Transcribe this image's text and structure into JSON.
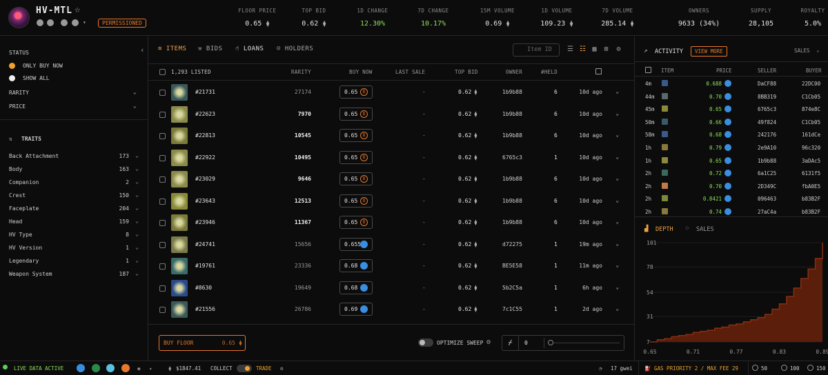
{
  "header": {
    "collection_name": "HV-MTL",
    "badge": "PERMISSIONED",
    "stats": [
      {
        "label": "FLOOR PRICE",
        "value": "0.65",
        "eth": true,
        "green": false
      },
      {
        "label": "TOP BID",
        "value": "0.62",
        "eth": true,
        "green": false
      },
      {
        "label": "1D CHANGE",
        "value": "12.30%",
        "eth": false,
        "green": true
      },
      {
        "label": "7D CHANGE",
        "value": "10.17%",
        "eth": false,
        "green": true
      },
      {
        "label": "15M VOLUME",
        "value": "0.69",
        "eth": true,
        "green": false
      },
      {
        "label": "1D VOLUME",
        "value": "109.23",
        "eth": true,
        "green": false
      },
      {
        "label": "7D VOLUME",
        "value": "285.14",
        "eth": true,
        "green": false
      },
      {
        "label": "OWNERS",
        "value": "9633 (34%)",
        "eth": false,
        "green": false
      },
      {
        "label": "SUPPLY",
        "value": "28,105",
        "eth": false,
        "green": false
      },
      {
        "label": "ROYALTY",
        "value": "5.0%",
        "eth": false,
        "green": false
      }
    ]
  },
  "sidebar": {
    "status_label": "STATUS",
    "only_buy_now": "ONLY BUY NOW",
    "show_all": "SHOW ALL",
    "rarity": "RARITY",
    "price": "PRICE",
    "traits_label": "TRAITS",
    "traits": [
      {
        "name": "Back Attachment",
        "count": "173"
      },
      {
        "name": "Body",
        "count": "163"
      },
      {
        "name": "Companion",
        "count": "2"
      },
      {
        "name": "Crest",
        "count": "150"
      },
      {
        "name": "Faceplate",
        "count": "204"
      },
      {
        "name": "Head",
        "count": "159"
      },
      {
        "name": "HV Type",
        "count": "8"
      },
      {
        "name": "HV Version",
        "count": "1"
      },
      {
        "name": "Legendary",
        "count": "1"
      },
      {
        "name": "Weapon System",
        "count": "187"
      }
    ]
  },
  "main": {
    "tabs": [
      "ITEMS",
      "BIDS",
      "LOANS",
      "HOLDERS"
    ],
    "search_placeholder": "Item ID",
    "columns": {
      "listed": "1,293 LISTED",
      "rarity": "RARITY",
      "buy_now": "BUY NOW",
      "last_sale": "LAST SALE",
      "top_bid": "TOP BID",
      "owner": "OWNER",
      "held": "#HELD"
    },
    "rows": [
      {
        "id": "#21731",
        "rarity": "27174",
        "bold": false,
        "price": "0.65",
        "coin": "org",
        "last": "-",
        "bid": "0.62",
        "owner": "1b9b88",
        "held": "6",
        "time": "10d ago",
        "thumb": "#3a5a5a"
      },
      {
        "id": "#22623",
        "rarity": "7970",
        "bold": true,
        "price": "0.65",
        "coin": "org",
        "last": "-",
        "bid": "0.62",
        "owner": "1b9b88",
        "held": "6",
        "time": "10d ago",
        "thumb": "#8a8a4a"
      },
      {
        "id": "#22813",
        "rarity": "10545",
        "bold": true,
        "price": "0.65",
        "coin": "org",
        "last": "-",
        "bid": "0.62",
        "owner": "1b9b88",
        "held": "6",
        "time": "10d ago",
        "thumb": "#7a7a3a"
      },
      {
        "id": "#22922",
        "rarity": "10495",
        "bold": true,
        "price": "0.65",
        "coin": "org",
        "last": "-",
        "bid": "0.62",
        "owner": "6765c3",
        "held": "1",
        "time": "10d ago",
        "thumb": "#8a8a4a"
      },
      {
        "id": "#23029",
        "rarity": "9646",
        "bold": true,
        "price": "0.65",
        "coin": "org",
        "last": "-",
        "bid": "0.62",
        "owner": "1b9b88",
        "held": "6",
        "time": "10d ago",
        "thumb": "#8a8a4a"
      },
      {
        "id": "#23643",
        "rarity": "12513",
        "bold": true,
        "price": "0.65",
        "coin": "org",
        "last": "-",
        "bid": "0.62",
        "owner": "1b9b88",
        "held": "6",
        "time": "10d ago",
        "thumb": "#8a8a3a"
      },
      {
        "id": "#23946",
        "rarity": "11367",
        "bold": true,
        "price": "0.65",
        "coin": "org",
        "last": "-",
        "bid": "0.62",
        "owner": "1b9b88",
        "held": "6",
        "time": "10d ago",
        "thumb": "#7a7a3a"
      },
      {
        "id": "#24741",
        "rarity": "15656",
        "bold": false,
        "price": "0.655",
        "coin": "blu",
        "last": "-",
        "bid": "0.62",
        "owner": "d72275",
        "held": "1",
        "time": "19m ago",
        "thumb": "#7a7a4a"
      },
      {
        "id": "#19761",
        "rarity": "23336",
        "bold": false,
        "price": "0.68",
        "coin": "blu",
        "last": "-",
        "bid": "0.62",
        "owner": "BE5E58",
        "held": "1",
        "time": "11m ago",
        "thumb": "#3a6a6a"
      },
      {
        "id": "#8630",
        "rarity": "19649",
        "bold": false,
        "price": "0.68",
        "coin": "blu",
        "last": "-",
        "bid": "0.62",
        "owner": "5b2C5a",
        "held": "1",
        "time": "6h ago",
        "thumb": "#2a4a8a"
      },
      {
        "id": "#21556",
        "rarity": "26786",
        "bold": false,
        "price": "0.69",
        "coin": "blu",
        "last": "-",
        "bid": "0.62",
        "owner": "7c1C55",
        "held": "1",
        "time": "2d ago",
        "thumb": "#3a5a5a"
      }
    ],
    "buy_floor_label": "BUY FLOOR",
    "buy_floor_price": "0.65",
    "optimize_sweep": "OPTIMIZE SWEEP",
    "sweep_count": "0"
  },
  "activity": {
    "title": "ACTIVITY",
    "view_more": "VIEW MORE",
    "filter": "SALES",
    "columns": {
      "item": "ITEM",
      "price": "PRICE",
      "seller": "SELLER",
      "buyer": "BUYER"
    },
    "rows": [
      {
        "time": "4m",
        "price": "0.688",
        "seller": "DaCF88",
        "buyer": "22DC00",
        "ic": "#3a5a8a"
      },
      {
        "time": "44m",
        "price": "0.70",
        "seller": "8BB319",
        "buyer": "C1Cb05",
        "ic": "#5a6a6a"
      },
      {
        "time": "45m",
        "price": "0.65",
        "seller": "6765c3",
        "buyer": "874e8C",
        "ic": "#8a8a3a"
      },
      {
        "time": "50m",
        "price": "0.66",
        "seller": "49f824",
        "buyer": "C1Cb05",
        "ic": "#3a5a6a"
      },
      {
        "time": "58m",
        "price": "0.68",
        "seller": "242176",
        "buyer": "161dCe",
        "ic": "#3a5a8a"
      },
      {
        "time": "1h",
        "price": "0.79",
        "seller": "2e9A10",
        "buyer": "96c320",
        "ic": "#8a7a3a"
      },
      {
        "time": "1h",
        "price": "0.65",
        "seller": "1b9b88",
        "buyer": "3aDAc5",
        "ic": "#8a8a3a"
      },
      {
        "time": "2h",
        "price": "0.72",
        "seller": "6a1C25",
        "buyer": "6131f5",
        "ic": "#3a6a5a"
      },
      {
        "time": "2h",
        "price": "0.70",
        "seller": "2D349C",
        "buyer": "fbA0E5",
        "ic": "#c07a4a"
      },
      {
        "time": "2h",
        "price": "0.8421",
        "seller": "096463",
        "buyer": "b83B2F",
        "ic": "#7a8a3a"
      },
      {
        "time": "2h",
        "price": "0.74",
        "seller": "27aC4a",
        "buyer": "b83B2F",
        "ic": "#8a7a3a"
      }
    ],
    "depth_tab": "DEPTH",
    "sales_tab": "SALES"
  },
  "chart_data": {
    "type": "area",
    "title": "",
    "xlabel": "",
    "ylabel": "",
    "x_ticks": [
      "0.65",
      "0.71",
      "0.77",
      "0.83",
      "0.89"
    ],
    "y_ticks": [
      "101",
      "78",
      "54",
      "31",
      "7"
    ],
    "xlim": [
      0.65,
      0.89
    ],
    "ylim": [
      7,
      101
    ],
    "x": [
      0.65,
      0.66,
      0.67,
      0.68,
      0.69,
      0.7,
      0.71,
      0.72,
      0.73,
      0.74,
      0.75,
      0.76,
      0.77,
      0.78,
      0.79,
      0.8,
      0.81,
      0.82,
      0.83,
      0.84,
      0.85,
      0.86,
      0.87,
      0.88,
      0.89
    ],
    "values": [
      7,
      9,
      10,
      12,
      13,
      14,
      16,
      17,
      18,
      20,
      21,
      23,
      24,
      26,
      28,
      30,
      33,
      38,
      43,
      50,
      58,
      67,
      76,
      86,
      101
    ],
    "color": "#8a2e12"
  },
  "footer": {
    "live": "LIVE DATA ACTIVE",
    "eth_price": "$1847.41",
    "collect": "COLLECT",
    "trade": "TRADE",
    "gas": "17 gwei",
    "gas_priority": "GAS PRIORITY 2 / MAX FEE 29",
    "n1": "50",
    "n2": "100",
    "n3": "150"
  },
  "colors": {
    "accent": "#e8792c",
    "green": "#8fe05a",
    "blue": "#3a8ee0"
  }
}
